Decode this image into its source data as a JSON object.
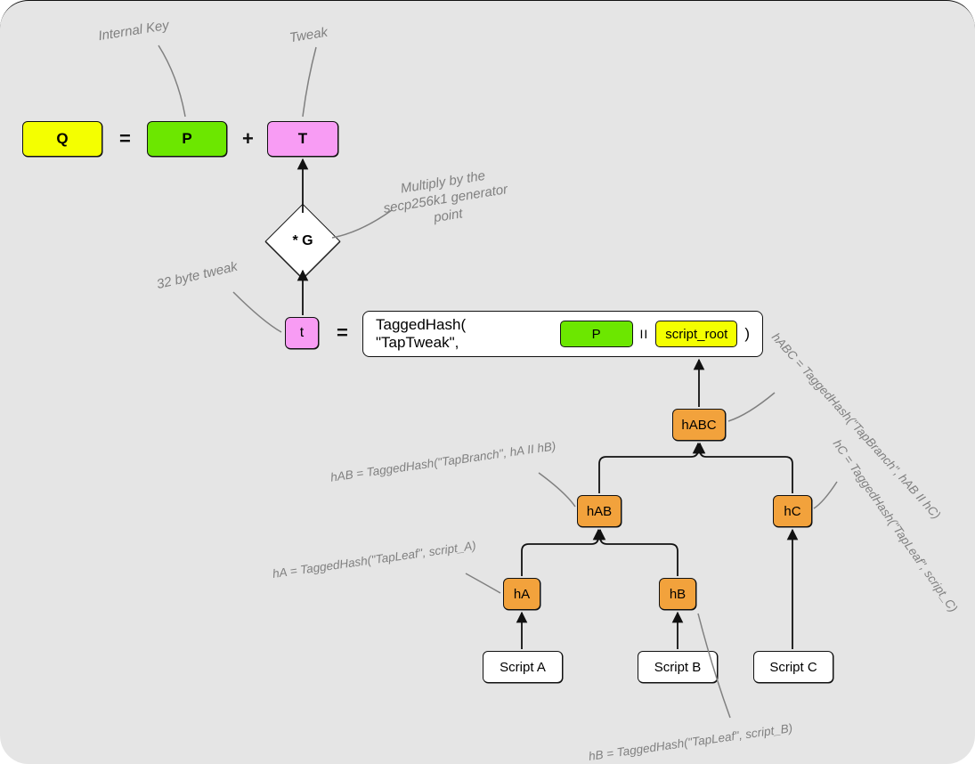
{
  "equation": {
    "Q": "Q",
    "eq1": "=",
    "P": "P",
    "plus": "+",
    "T": "T"
  },
  "labels": {
    "internal_key": "Internal Key",
    "tweak": "Tweak",
    "generator": "Multiply by the\nsecp256k1 generator\npoint",
    "tweak32": "32 byte tweak"
  },
  "diamond": "* G",
  "tweak_scalar": {
    "t": "t",
    "eq": "="
  },
  "taghash": {
    "prefix": "TaggedHash( \"TapTweak\",",
    "P": "P",
    "concat": "II",
    "root_label": "script_root",
    "suffix": ")"
  },
  "tree": {
    "hABC": "hABC",
    "hAB": "hAB",
    "hC": "hC",
    "hA": "hA",
    "hB": "hB",
    "scriptA": "Script A",
    "scriptB": "Script B",
    "scriptC": "Script C"
  },
  "tree_annot": {
    "hABC": "hABC = TaggedHash(\"TapBranch\", hAB II hC)",
    "hAB": "hAB = TaggedHash(\"TapBranch\", hA II hB)",
    "hC": "hC = TaggedHash(\"TapLeaf\", script_C)",
    "hA": "hA = TaggedHash(\"TapLeaf\", script_A)",
    "hB": "hB = TaggedHash(\"TapLeaf\", script_B)"
  },
  "colors": {
    "yellow": "#f4ff00",
    "green": "#6ce700",
    "pink": "#f89cf4",
    "orange": "#f2a23c"
  }
}
